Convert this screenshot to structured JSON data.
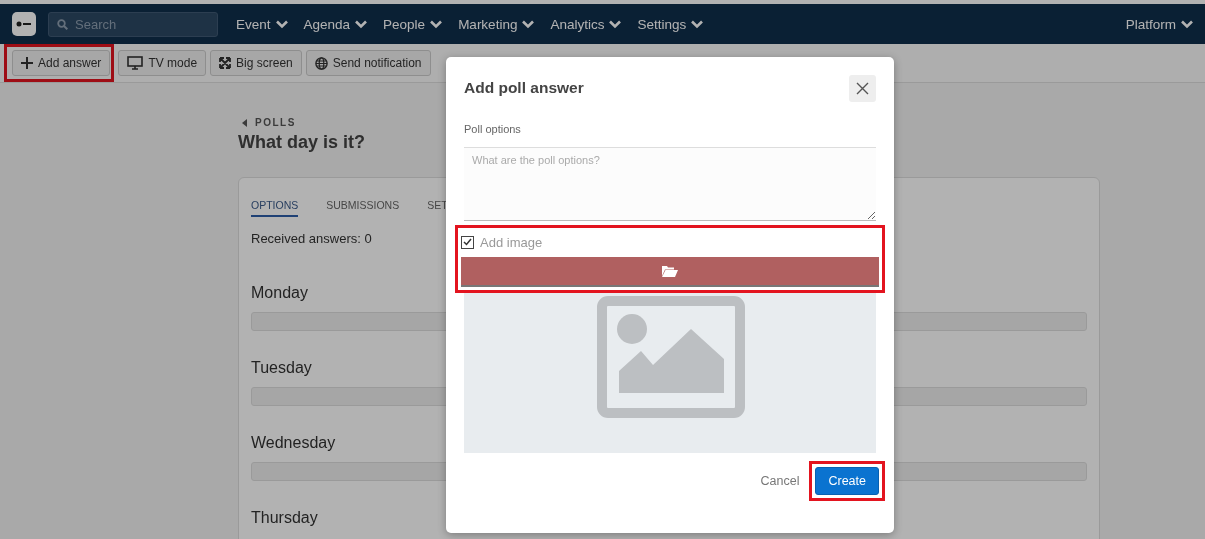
{
  "nav": {
    "search": {
      "placeholder": "Search"
    },
    "menus": [
      {
        "label": "Event"
      },
      {
        "label": "Agenda"
      },
      {
        "label": "People"
      },
      {
        "label": "Marketing"
      },
      {
        "label": "Analytics"
      },
      {
        "label": "Settings"
      }
    ],
    "right_menu": {
      "label": "Platform"
    }
  },
  "toolbar": {
    "buttons": [
      {
        "kind": "add",
        "label": "Add answer",
        "highlighted": true
      },
      {
        "kind": "tv",
        "label": "TV mode",
        "highlighted": false
      },
      {
        "kind": "expand",
        "label": "Big screen",
        "highlighted": false
      },
      {
        "kind": "globe",
        "label": "Send notification",
        "highlighted": false
      }
    ]
  },
  "breadcrumb": "POLLS",
  "title": "What day is it?",
  "tabs": [
    {
      "label": "OPTIONS",
      "selected": true
    },
    {
      "label": "SUBMISSIONS",
      "selected": false
    },
    {
      "label": "SET",
      "selected": false
    }
  ],
  "received": "Received answers: 0",
  "options": [
    {
      "name": "Monday",
      "level": 0
    },
    {
      "name": "Tuesday",
      "level": 0
    },
    {
      "name": "Wednesday",
      "level": 0
    },
    {
      "name": "Thursday"
    }
  ],
  "dialog": {
    "title": "Add poll answer",
    "field_label": "Poll options",
    "field": {
      "placeholder": "What are the poll options?"
    },
    "add_image": {
      "label": "Add image",
      "checked": true,
      "highlighted": true
    },
    "image": {
      "kind": "placeholder"
    },
    "buttons": [
      {
        "kind": "cancel",
        "label": "Cancel",
        "highlighted": false
      },
      {
        "kind": "primary",
        "label": "Create",
        "highlighted": true
      }
    ]
  }
}
